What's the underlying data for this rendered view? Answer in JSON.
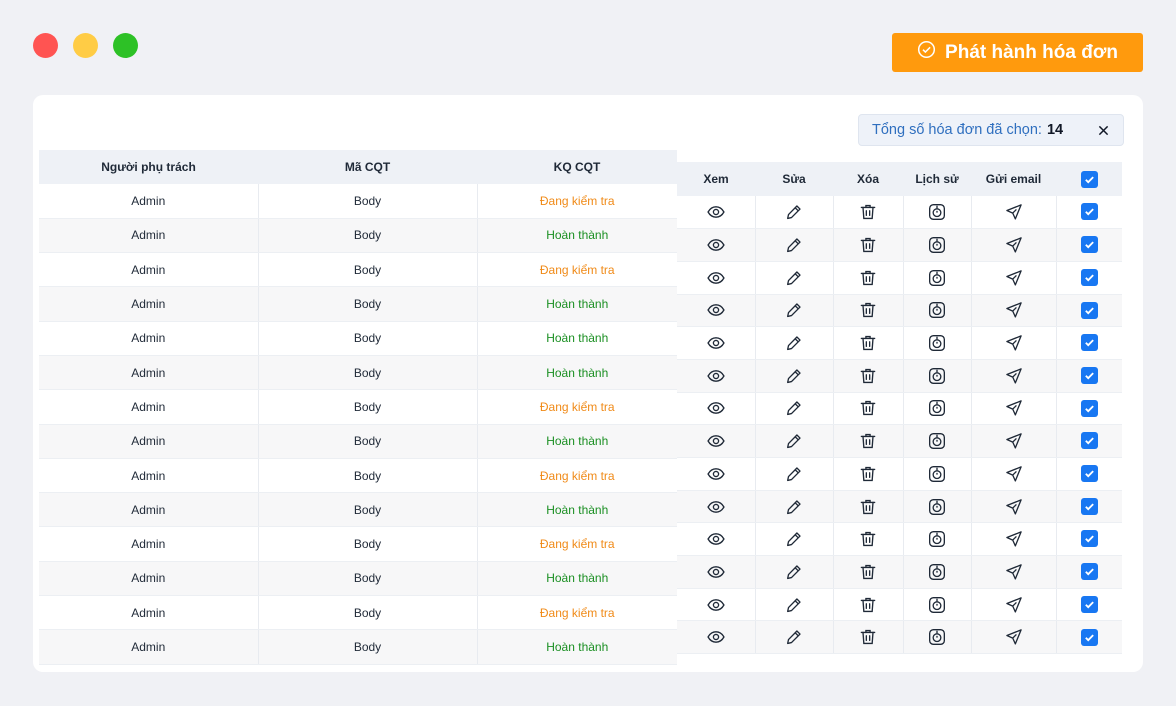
{
  "window": {
    "controls": [
      "close",
      "minimize",
      "maximize"
    ]
  },
  "header": {
    "issue_button_label": "Phát hành hóa đơn",
    "accent": "#ff9a0d"
  },
  "summary": {
    "label": "Tổng số hóa đơn đã chọn:",
    "count": "14"
  },
  "left_columns": [
    "Người phụ trách",
    "Mã CQT",
    "KQ CQT"
  ],
  "action_columns": [
    "Xem",
    "Sửa",
    "Xóa",
    "Lịch sử",
    "Gửi email"
  ],
  "status_colors": {
    "warn": "#f08a17",
    "done": "#1a8f22"
  },
  "rows": [
    {
      "owner": "Admin",
      "code": "Body",
      "status": "Đang kiểm tra",
      "state": "warn",
      "checked": true
    },
    {
      "owner": "Admin",
      "code": "Body",
      "status": "Hoàn thành",
      "state": "done",
      "checked": true
    },
    {
      "owner": "Admin",
      "code": "Body",
      "status": "Đang kiểm tra",
      "state": "warn",
      "checked": true
    },
    {
      "owner": "Admin",
      "code": "Body",
      "status": "Hoàn thành",
      "state": "done",
      "checked": true
    },
    {
      "owner": "Admin",
      "code": "Body",
      "status": "Hoàn thành",
      "state": "done",
      "checked": true
    },
    {
      "owner": "Admin",
      "code": "Body",
      "status": "Hoàn thành",
      "state": "done",
      "checked": true
    },
    {
      "owner": "Admin",
      "code": "Body",
      "status": "Đang kiểm tra",
      "state": "warn",
      "checked": true
    },
    {
      "owner": "Admin",
      "code": "Body",
      "status": "Hoàn thành",
      "state": "done",
      "checked": true
    },
    {
      "owner": "Admin",
      "code": "Body",
      "status": "Đang kiểm tra",
      "state": "warn",
      "checked": true
    },
    {
      "owner": "Admin",
      "code": "Body",
      "status": "Hoàn thành",
      "state": "done",
      "checked": true
    },
    {
      "owner": "Admin",
      "code": "Body",
      "status": "Đang kiểm tra",
      "state": "warn",
      "checked": true
    },
    {
      "owner": "Admin",
      "code": "Body",
      "status": "Hoàn thành",
      "state": "done",
      "checked": true
    },
    {
      "owner": "Admin",
      "code": "Body",
      "status": "Đang kiểm tra",
      "state": "warn",
      "checked": true
    },
    {
      "owner": "Admin",
      "code": "Body",
      "status": "Hoàn thành",
      "state": "done",
      "checked": true
    }
  ],
  "icons": {
    "view": "eye-icon",
    "edit": "pencil-icon",
    "delete": "trash-icon",
    "history": "history-icon",
    "email": "send-icon"
  }
}
